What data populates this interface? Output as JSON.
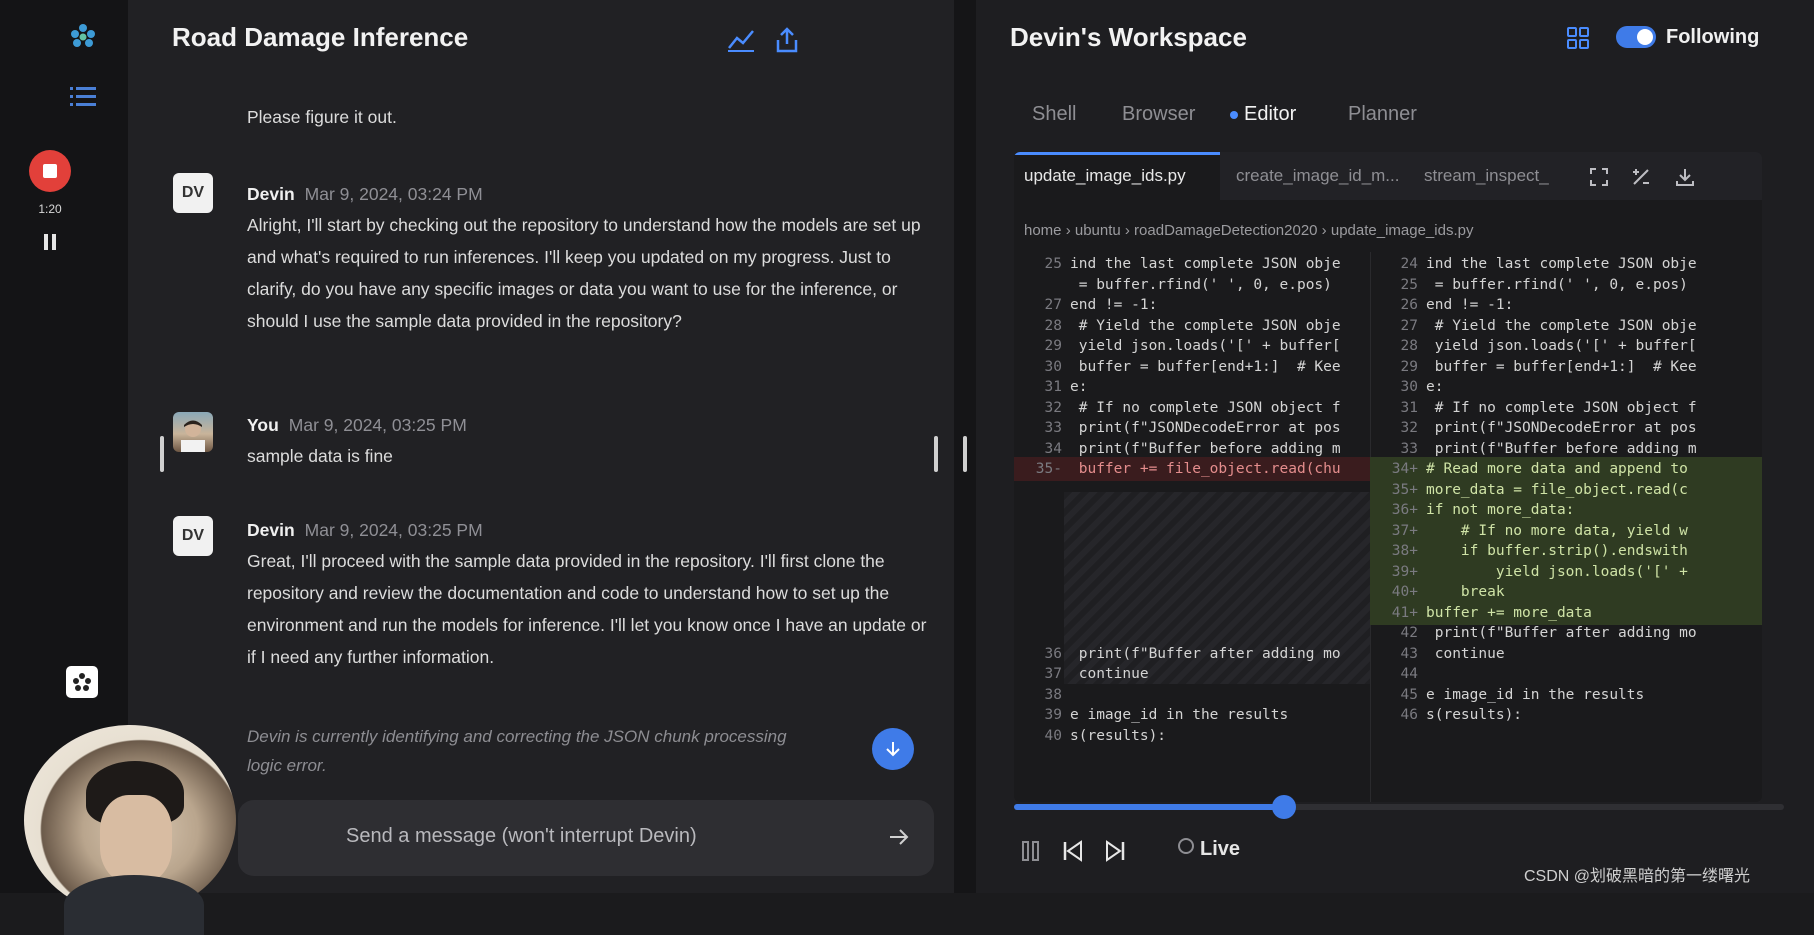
{
  "rail": {
    "recording_time": "1:20"
  },
  "chat": {
    "title": "Road Damage Inference",
    "messages": [
      {
        "text": "Please figure it out."
      },
      {
        "avatar": "DV",
        "author": "Devin",
        "time": "Mar 9, 2024, 03:24 PM",
        "text": "Alright, I'll start by checking out the repository to understand how the models are set up and what's required to run inferences. I'll keep you updated on my progress. Just to clarify, do you have any specific images or data you want to use for the inference, or should I use the sample data provided in the repository?"
      },
      {
        "author": "You",
        "time": "Mar 9, 2024, 03:25 PM",
        "text": "sample data is fine"
      },
      {
        "avatar": "DV",
        "author": "Devin",
        "time": "Mar 9, 2024, 03:25 PM",
        "text": "Great, I'll proceed with the sample data provided in the repository. I'll first clone the repository and review the documentation and code to understand how to set up the environment and run the models for inference. I'll let you know once I have an update or if I need any further information."
      }
    ],
    "status": "Devin is currently identifying and correcting the JSON chunk processing logic error.",
    "input_placeholder": "Send a message (won't interrupt Devin)"
  },
  "workspace": {
    "title": "Devin's Workspace",
    "following_label": "Following",
    "following_on": true,
    "tabs": [
      "Shell",
      "Browser",
      "Editor",
      "Planner"
    ],
    "active_tab": "Editor",
    "file_tabs": [
      "update_image_ids.py",
      "create_image_id_m...",
      "stream_inspect_"
    ],
    "breadcrumb": "home › ubuntu › roadDamageDetection2020 › update_image_ids.py",
    "left_code": [
      {
        "n": "25",
        "t": "ind the last complete JSON obje",
        "k": ""
      },
      {
        "n": "",
        "t": " = buffer.rfind(' ', 0, e.pos)",
        "k": ""
      },
      {
        "n": "27",
        "t": "end != -1:",
        "k": ""
      },
      {
        "n": "28",
        "t": " # Yield the complete JSON obje",
        "k": ""
      },
      {
        "n": "29",
        "t": " yield json.loads('[' + buffer[",
        "k": ""
      },
      {
        "n": "30",
        "t": " buffer = buffer[end+1:]  # Kee",
        "k": ""
      },
      {
        "n": "31",
        "t": "e:",
        "k": ""
      },
      {
        "n": "32",
        "t": " # If no complete JSON object f",
        "k": ""
      },
      {
        "n": "33",
        "t": " print(f\"JSONDecodeError at pos",
        "k": ""
      },
      {
        "n": "34",
        "t": " print(f\"Buffer before adding m",
        "k": ""
      },
      {
        "n": "35-",
        "t": " buffer += file_object.read(chu",
        "k": "del"
      },
      {
        "n": "36",
        "t": " print(f\"Buffer after adding mo",
        "k": ""
      },
      {
        "n": "37",
        "t": " continue",
        "k": ""
      },
      {
        "n": "38",
        "t": "",
        "k": ""
      },
      {
        "n": "39",
        "t": "e image_id in the results",
        "k": ""
      },
      {
        "n": "40",
        "t": "s(results):",
        "k": ""
      }
    ],
    "right_code": [
      {
        "n": "24",
        "t": "ind the last complete JSON obje",
        "k": ""
      },
      {
        "n": "25",
        "t": " = buffer.rfind(' ', 0, e.pos)",
        "k": ""
      },
      {
        "n": "26",
        "t": "end != -1:",
        "k": ""
      },
      {
        "n": "27",
        "t": " # Yield the complete JSON obje",
        "k": ""
      },
      {
        "n": "28",
        "t": " yield json.loads('[' + buffer[",
        "k": ""
      },
      {
        "n": "29",
        "t": " buffer = buffer[end+1:]  # Kee",
        "k": ""
      },
      {
        "n": "30",
        "t": "e:",
        "k": ""
      },
      {
        "n": "31",
        "t": " # If no complete JSON object f",
        "k": ""
      },
      {
        "n": "32",
        "t": " print(f\"JSONDecodeError at pos",
        "k": ""
      },
      {
        "n": "33",
        "t": " print(f\"Buffer before adding m",
        "k": ""
      },
      {
        "n": "34+",
        "t": "# Read more data and append to",
        "k": "add"
      },
      {
        "n": "35+",
        "t": "more_data = file_object.read(c",
        "k": "add"
      },
      {
        "n": "36+",
        "t": "if not more_data:",
        "k": "add"
      },
      {
        "n": "37+",
        "t": "    # If no more data, yield w",
        "k": "add"
      },
      {
        "n": "38+",
        "t": "    if buffer.strip().endswith",
        "k": "add"
      },
      {
        "n": "39+",
        "t": "        yield json.loads('[' +",
        "k": "add"
      },
      {
        "n": "40+",
        "t": "    break",
        "k": "add"
      },
      {
        "n": "41+",
        "t": "buffer += more_data",
        "k": "add"
      },
      {
        "n": "42",
        "t": " print(f\"Buffer after adding mo",
        "k": ""
      },
      {
        "n": "43",
        "t": " continue",
        "k": ""
      },
      {
        "n": "44",
        "t": "",
        "k": ""
      },
      {
        "n": "45",
        "t": "e image_id in the results",
        "k": ""
      },
      {
        "n": "46",
        "t": "s(results):",
        "k": ""
      }
    ],
    "playback_progress": 0.35,
    "live_label": "Live"
  },
  "watermark": "CSDN @划破黑暗的第一缕曙光",
  "colors": {
    "accent": "#3f7be8",
    "record": "#e2403a",
    "diff_add": "#2f3b22",
    "diff_del": "#3a1c1e"
  }
}
